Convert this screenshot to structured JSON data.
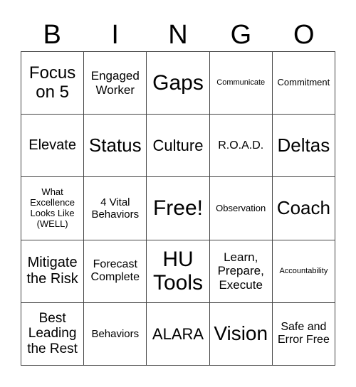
{
  "header": {
    "letters": [
      "B",
      "I",
      "N",
      "G",
      "O"
    ]
  },
  "card": {
    "rows": [
      [
        "Focus on 5",
        "Engaged Worker",
        "Gaps",
        "Communicate",
        "Commitment"
      ],
      [
        "Elevate",
        "Status",
        "Culture",
        "R.O.A.D.",
        "Deltas"
      ],
      [
        "What Excellence Looks Like (WELL)",
        "4 Vital Behaviors",
        "Free!",
        "Observation",
        "Coach"
      ],
      [
        "Mitigate the Risk",
        "Forecast Complete",
        "HU Tools",
        "Learn, Prepare, Execute",
        "Accountability"
      ],
      [
        "Best Leading the Rest",
        "Behaviors",
        "ALARA",
        "Vision",
        "Safe and Error Free"
      ]
    ]
  }
}
